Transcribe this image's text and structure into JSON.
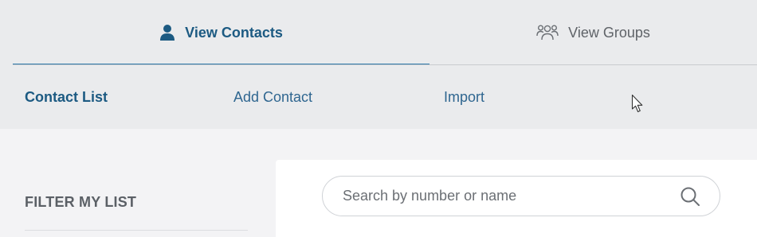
{
  "tabs": {
    "contacts": {
      "label": "View Contacts",
      "icon": "person-icon",
      "active": true
    },
    "groups": {
      "label": "View Groups",
      "icon": "group-icon",
      "active": false
    }
  },
  "subnav": {
    "items": [
      {
        "label": "Contact List",
        "active": true
      },
      {
        "label": "Add Contact",
        "active": false
      },
      {
        "label": "Import",
        "active": false
      }
    ]
  },
  "filter": {
    "title": "FILTER MY LIST"
  },
  "search": {
    "placeholder": "Search by number or name",
    "value": ""
  },
  "colors": {
    "accent": "#1c5a82",
    "underline": "#2b77a8",
    "nav_background": "#eaebed",
    "page_background": "#f3f3f5"
  }
}
